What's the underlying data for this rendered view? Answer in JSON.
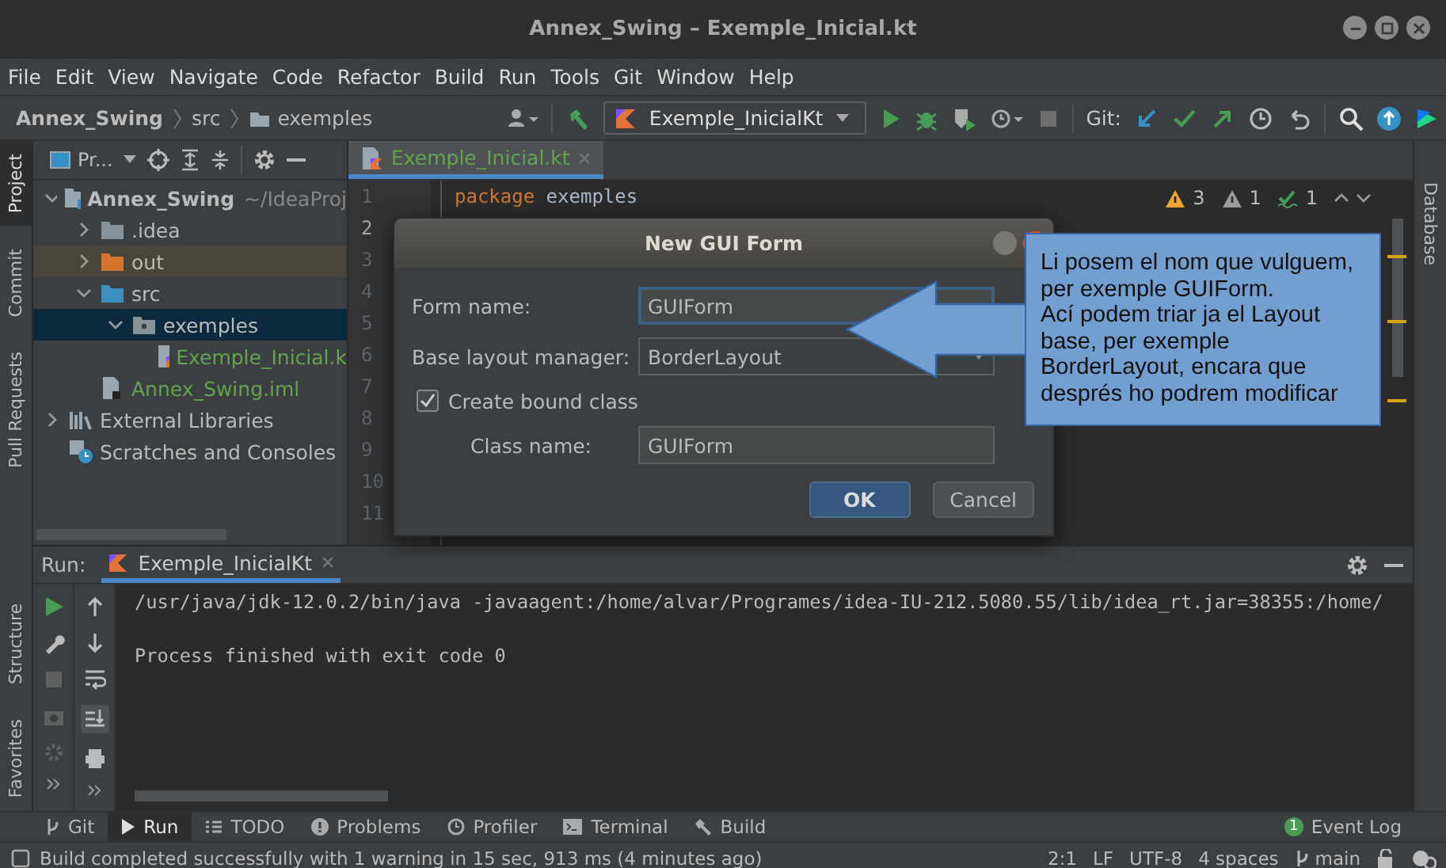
{
  "window": {
    "title": "Annex_Swing – Exemple_Inicial.kt"
  },
  "menu": [
    "File",
    "Edit",
    "View",
    "Navigate",
    "Code",
    "Refactor",
    "Build",
    "Run",
    "Tools",
    "Git",
    "Window",
    "Help"
  ],
  "breadcrumbs": [
    "Annex_Swing",
    "src",
    "exemples"
  ],
  "toolbar": {
    "run_config": "Exemple_InicialKt",
    "git_label": "Git:"
  },
  "left_tool_tabs": [
    {
      "label": "Project",
      "selected": true
    },
    {
      "label": "Commit",
      "selected": false
    },
    {
      "label": "Pull Requests",
      "selected": false
    }
  ],
  "lower_left_tool_tabs": [
    {
      "label": "Structure",
      "selected": false
    },
    {
      "label": "Favorites",
      "selected": false
    }
  ],
  "right_tool_tabs": [
    {
      "label": "Database",
      "selected": false
    }
  ],
  "project_panel": {
    "title": "Pr...",
    "tree": [
      {
        "label": "Annex_Swing",
        "hint": "~/IdeaProj",
        "kind": "module",
        "expanded": true,
        "selected": false,
        "children": [
          {
            "label": ".idea",
            "kind": "folder",
            "expanded": false,
            "selected": false
          },
          {
            "label": "out",
            "kind": "excluded",
            "expanded": false,
            "selected": false
          },
          {
            "label": "src",
            "kind": "source",
            "expanded": true,
            "selected": false,
            "children": [
              {
                "label": "exemples",
                "kind": "package",
                "expanded": true,
                "selected": true,
                "children": [
                  {
                    "label": "Exemple_Inicial.k",
                    "kind": "kotlin",
                    "added": true,
                    "selected": false
                  }
                ]
              }
            ]
          },
          {
            "label": "Annex_Swing.iml",
            "kind": "iml",
            "added": true,
            "selected": false
          }
        ]
      },
      {
        "label": "External Libraries",
        "kind": "libraries",
        "expanded": false,
        "selected": false
      },
      {
        "label": "Scratches and Consoles",
        "kind": "scratches",
        "selected": false
      }
    ]
  },
  "editor": {
    "tabs": [
      {
        "label": "Exemple_Inicial.kt",
        "selected": true
      }
    ],
    "line_numbers": [
      "1",
      "2",
      "3",
      "4",
      "5",
      "6",
      "7",
      "8",
      "9",
      "10",
      "11"
    ],
    "code": [
      {
        "keyword": "package",
        "text": "exemples"
      }
    ],
    "inspections": [
      {
        "kind": "warning",
        "count": "3"
      },
      {
        "kind": "weak",
        "count": "1"
      },
      {
        "kind": "typo",
        "count": "1"
      }
    ]
  },
  "dialog": {
    "title": "New GUI Form",
    "fields": [
      {
        "kind": "text",
        "label": "Form name:",
        "value": "GUIForm",
        "focused": true,
        "indented": false
      },
      {
        "kind": "dropdown",
        "label": "Base layout manager:",
        "value": "BorderLayout"
      },
      {
        "kind": "checkbox",
        "label": "Create bound class",
        "checked": true
      },
      {
        "kind": "text",
        "label": "Class name:",
        "value": "GUIForm",
        "focused": false,
        "indented": true
      }
    ],
    "buttons": [
      {
        "label": "OK",
        "kind": "primary"
      },
      {
        "label": "Cancel",
        "kind": "secondary"
      }
    ]
  },
  "callout": {
    "text": "Li posem el nom que vulguem, per exemple GUIForm.\nAcí podem triar ja el Layout base, per exemple BorderLayout, encara que després ho podrem modificar"
  },
  "run_panel": {
    "label": "Run:",
    "tabs": [
      {
        "label": "Exemple_InicialKt",
        "selected": true
      }
    ],
    "output": [
      "/usr/java/jdk-12.0.2/bin/java -javaagent:/home/alvar/Programes/idea-IU-212.5080.55/lib/idea_rt.jar=38355:/home/",
      "Process finished with exit code 0"
    ]
  },
  "tool_windows": [
    {
      "label": "Git",
      "kind": "git",
      "selected": false
    },
    {
      "label": "Run",
      "kind": "run",
      "selected": true
    },
    {
      "label": "TODO",
      "kind": "todo",
      "selected": false
    },
    {
      "label": "Problems",
      "kind": "problems",
      "selected": false
    },
    {
      "label": "Profiler",
      "kind": "profiler",
      "selected": false
    },
    {
      "label": "Terminal",
      "kind": "terminal",
      "selected": false
    },
    {
      "label": "Build",
      "kind": "build",
      "selected": false
    }
  ],
  "event_log": {
    "label": "Event Log",
    "badge": "1"
  },
  "status_bar": {
    "message": "Build completed successfully with 1 warning in 15 sec, 913 ms (4 minutes ago)",
    "items": [
      "2:1",
      "LF",
      "UTF-8",
      "4 spaces"
    ],
    "branch": "main"
  }
}
